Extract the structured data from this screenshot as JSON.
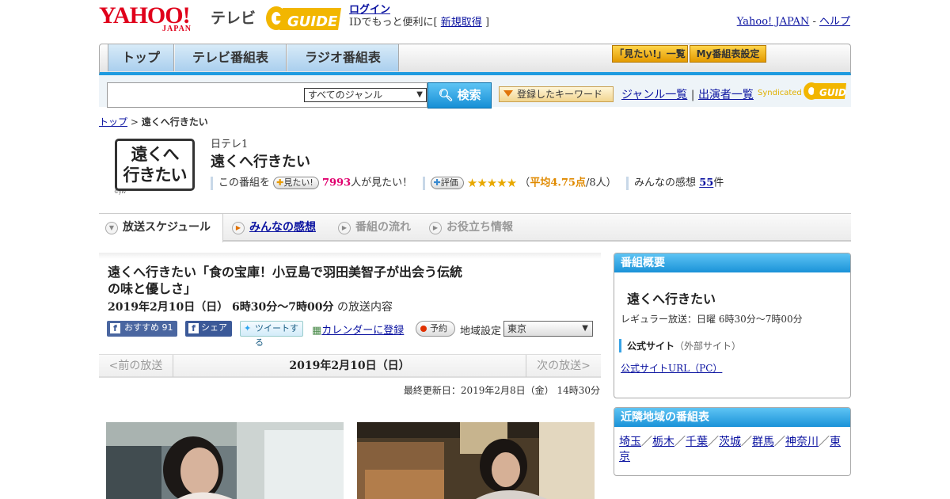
{
  "header": {
    "yahoo_text": "YAHOO!",
    "japan_text": "JAPAN",
    "tv_text": "テレビ",
    "gguide_text": "GUIDE",
    "login_link": "ログイン",
    "login_sub": "IDでもっと便利に[",
    "signup_link": "新規取得",
    "login_sub_end": "]",
    "yahoo_japan_link": "Yahoo! JAPAN",
    "sep": " - ",
    "help_link": "ヘルプ"
  },
  "nav": {
    "tabs": [
      "トップ",
      "テレビ番組表",
      "ラジオ番組表"
    ],
    "mitai_button": "「見たい!」一覧",
    "my_button": "My番組表設定"
  },
  "search": {
    "genre_selected": "すべてのジャンル",
    "search_button": "検索",
    "keyword_button": "登録したキーワード",
    "genre_list_link": "ジャンル一覧",
    "divider": "|",
    "performer_link": "出演者一覧",
    "syndicated": "Syndicated",
    "syndicated_brand": "GUIDE"
  },
  "breadcrumb": {
    "home": "トップ",
    "sep": " > ",
    "current": "遠くへ行きたい"
  },
  "program": {
    "logo_line1": "遠くへ",
    "logo_line2": "行きたい",
    "logo_credit": "©ytv",
    "channel": "日テレ1",
    "title": "遠くへ行きたい",
    "mitai_prefix": "この番組を",
    "mitai_pill": "見たい!",
    "mitai_count": "7993",
    "mitai_suffix": "人が見たい！",
    "rate_pill": "評価",
    "stars": "★★★★★",
    "avg_open": "（",
    "avg_label": "平均4.75点",
    "avg_people": "/8人）",
    "kansou_label": "みんなの感想",
    "kansou_count": "55",
    "kansou_unit": "件",
    "rating": 4.75
  },
  "subtabs": [
    "放送スケジュール",
    "みんなの感想",
    "番組の流れ",
    "お役立ち情報"
  ],
  "episode": {
    "title": "遠くへ行きたい「食の宝庫！小豆島で羽田美智子が出会う伝統の味と優しさ」",
    "date_bold": "2019年2月10日（日） 6時30分～7時00分",
    "date_suffix": "の放送内容",
    "fb_recommend": "おすすめ",
    "fb_count": "91",
    "fb_share": "シェア",
    "tweet": "ツイートする",
    "calendar_link": "カレンダーに登録",
    "reserve": "予約",
    "region_label": "地域設定",
    "region_selected": "東京",
    "prev": "<前の放送",
    "current": "2019年2月10日（日）",
    "next": "次の放送>",
    "updated": "最終更新日：2019年2月8日（金） 14時30分"
  },
  "overview": {
    "header": "番組概要",
    "title": "遠くへ行きたい",
    "regular": "レギュラー放送：日曜 6時30分～7時00分",
    "official_label": "公式サイト",
    "official_note": "（外部サイト）",
    "official_url": "公式サイトURL（PC）"
  },
  "nearby": {
    "header": "近隣地域の番組表",
    "regions": [
      "埼玉",
      "栃木",
      "千葉",
      "茨城",
      "群馬",
      "神奈川",
      "東京"
    ]
  },
  "colors": {
    "accent_blue": "#1e9be0",
    "yahoo_red": "#e0001b",
    "star_gold": "#e8a800",
    "pink": "#e0006e"
  }
}
